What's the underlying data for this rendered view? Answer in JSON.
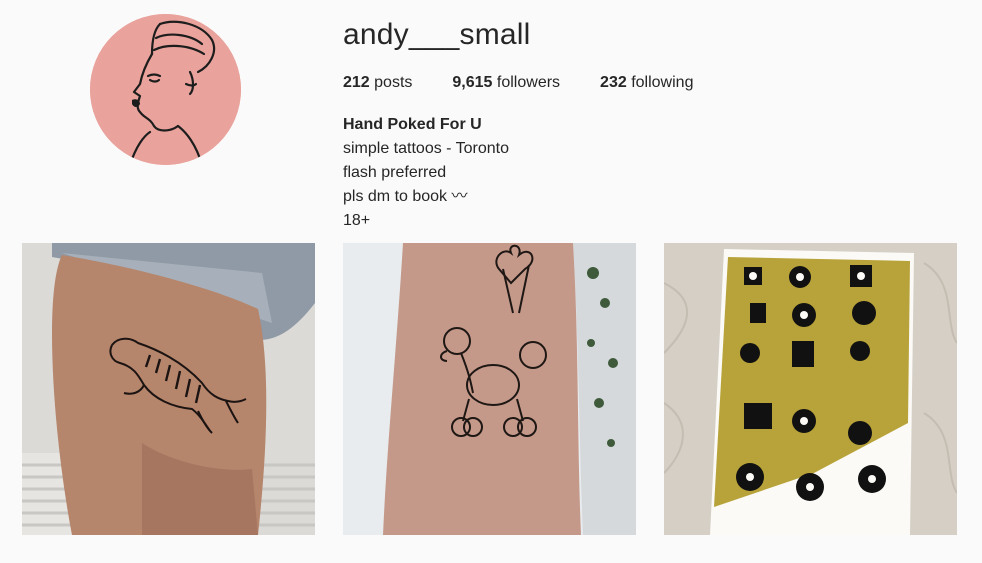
{
  "profile": {
    "username": "andy___small",
    "posts_count": "212",
    "posts_label": "posts",
    "followers_count": "9,615",
    "followers_label": "followers",
    "following_count": "232",
    "following_label": "following",
    "full_name": "Hand Poked For U",
    "bio_lines": [
      "simple tattoos - Toronto",
      "flash preferred",
      "pls dm to book 〰",
      "18+"
    ]
  },
  "colors": {
    "background": "#fafafa",
    "text": "#262626",
    "avatar_bg": "#e9a39c",
    "mustard": "#b8a33a"
  },
  "posts": [
    {
      "subject": "tiger-tattoo"
    },
    {
      "subject": "poodle-tattoo"
    },
    {
      "subject": "flash-sheet"
    }
  ]
}
